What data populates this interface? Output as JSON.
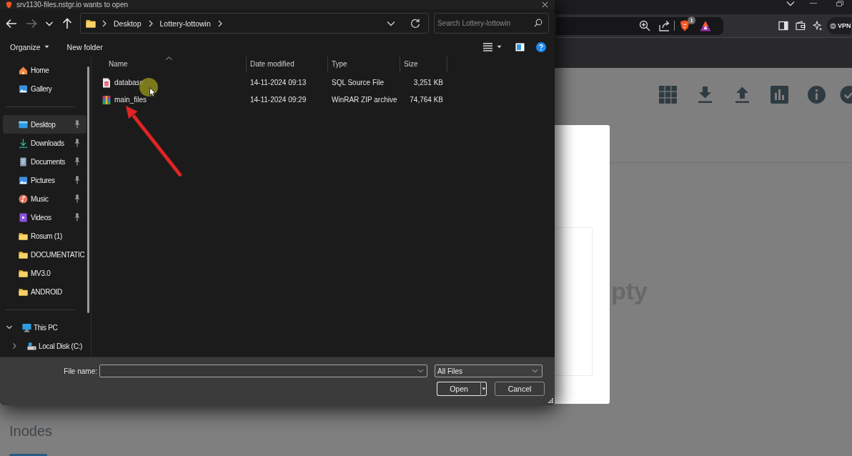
{
  "browser": {
    "shields_count": "1",
    "vpn_label": "VPN",
    "page": {
      "partial_text": "pty",
      "heading": "Inodes"
    }
  },
  "dialog": {
    "title": "srv1130-files.nstgr.io wants to open",
    "nav": [
      {
        "kind": "back",
        "disabled": false
      },
      {
        "kind": "forward",
        "disabled": true
      },
      {
        "kind": "recent",
        "disabled": false
      },
      {
        "kind": "up",
        "disabled": false
      }
    ],
    "path": [
      "Desktop",
      "Lottery-lottowin"
    ],
    "search": {
      "placeholder": "Search Lottery-lottowin"
    },
    "commands": [
      {
        "label": "Organize",
        "kind": "menu"
      },
      {
        "label": "New folder",
        "kind": "plain"
      }
    ],
    "sidebar": {
      "sections": [
        [
          {
            "label": "Home",
            "kind": "home",
            "pinned": false,
            "selected": false
          },
          {
            "label": "Gallery",
            "kind": "gallery",
            "pinned": false,
            "selected": false
          }
        ],
        [
          {
            "label": "Desktop",
            "kind": "desktop",
            "pinned": true,
            "selected": true
          },
          {
            "label": "Downloads",
            "kind": "downloads",
            "pinned": true,
            "selected": false
          },
          {
            "label": "Documents",
            "kind": "documents",
            "pinned": true,
            "selected": false
          },
          {
            "label": "Pictures",
            "kind": "pictures",
            "pinned": true,
            "selected": false
          },
          {
            "label": "Music",
            "kind": "music",
            "pinned": true,
            "selected": false
          },
          {
            "label": "Videos",
            "kind": "videos",
            "pinned": true,
            "selected": false
          },
          {
            "label": "Rosum (1)",
            "kind": "folder",
            "pinned": false,
            "selected": false
          },
          {
            "label": "DOCUMENTATIC",
            "kind": "folder",
            "pinned": false,
            "selected": false
          },
          {
            "label": "MV3.0",
            "kind": "folder",
            "pinned": false,
            "selected": false
          },
          {
            "label": "ANDROID",
            "kind": "folder",
            "pinned": false,
            "selected": false
          }
        ]
      ],
      "tree": [
        {
          "label": "This PC",
          "kind": "pc",
          "expanded": true,
          "selected": false,
          "children": [
            {
              "label": "Local Disk (C:)",
              "kind": "disk",
              "expanded": false,
              "selected": false
            }
          ]
        }
      ]
    },
    "columns": [
      {
        "label": "Name",
        "sorted": true
      },
      {
        "label": "Date modified",
        "sorted": false
      },
      {
        "label": "Type",
        "sorted": false
      },
      {
        "label": "Size",
        "sorted": false
      }
    ],
    "files": [
      {
        "name": "database",
        "kind": "sql",
        "date_modified": "14-11-2024 09:13",
        "type": "SQL Source File",
        "size": "3,251 KB"
      },
      {
        "name": "main_files",
        "kind": "archive",
        "date_modified": "14-11-2024 09:29",
        "type": "WinRAR ZIP archive",
        "size": "74,764 KB"
      }
    ],
    "file_name_label": "File name:",
    "filter": "All Files",
    "buttons": [
      {
        "label": "Open",
        "kind": "split"
      },
      {
        "label": "Cancel",
        "kind": "plain"
      }
    ]
  }
}
